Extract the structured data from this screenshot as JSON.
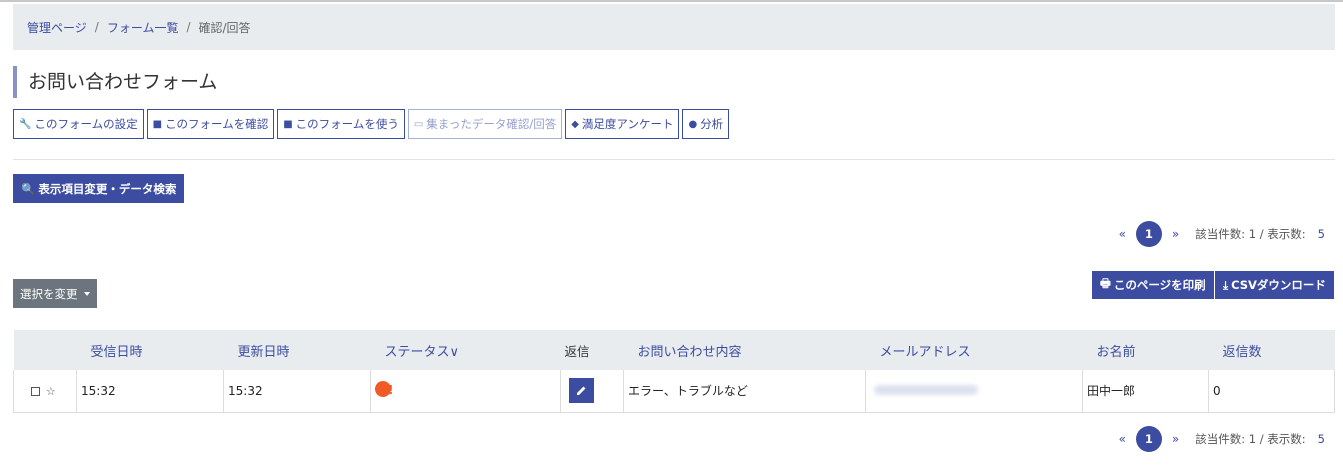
{
  "breadcrumb": {
    "item1": "管理ページ",
    "item2": "フォーム一覧",
    "current": "確認/回答",
    "separator": "/"
  },
  "page_title": "お問い合わせフォーム",
  "actions": {
    "settings": "このフォームの設定",
    "confirm": "このフォームを確認",
    "use": "このフォームを使う",
    "data": "集まったデータ確認/回答",
    "survey": "満足度アンケート",
    "analysis": "分析"
  },
  "search_button": "表示項目変更・データ検索",
  "select_change": "選択を変更",
  "print_button": "このページを印刷",
  "csv_button": "CSVダウンロード",
  "pagination": {
    "prev": "«",
    "page": "1",
    "next": "»",
    "count_text": "該当件数: 1 / 表示数:",
    "per_page": "5"
  },
  "table": {
    "headers": [
      "受信日時",
      "更新日時",
      "ステータス∨",
      "返信",
      "お問い合わせ内容",
      "メールアドレス",
      "お名前",
      "返信数"
    ],
    "rows": [
      {
        "received": "15:32",
        "updated": "15:32",
        "content": "エラー、トラブルなど",
        "name": "田中一郎",
        "reply_count": "0"
      }
    ]
  },
  "colors": {
    "primary": "#3c4ca0",
    "status": "#f15a24",
    "gray_button": "#6c757d"
  }
}
